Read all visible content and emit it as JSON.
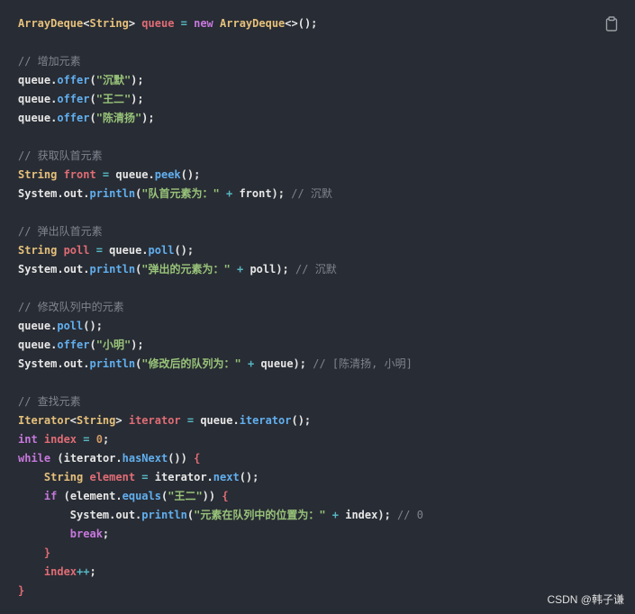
{
  "watermark": "CSDN @韩子谦",
  "copy_icon": "clipboard-icon",
  "lines": [
    [
      [
        "type",
        "ArrayDeque"
      ],
      [
        "punc",
        "<"
      ],
      [
        "type",
        "String"
      ],
      [
        "punc",
        "> "
      ],
      [
        "var",
        "queue"
      ],
      [
        "op",
        " = "
      ],
      [
        "kw",
        "new "
      ],
      [
        "type",
        "ArrayDeque"
      ],
      [
        "punc",
        "<>();"
      ]
    ],
    [],
    [
      [
        "cmt",
        "// 增加元素"
      ]
    ],
    [
      [
        "plain",
        "queue."
      ],
      [
        "fn",
        "offer"
      ],
      [
        "punc",
        "("
      ],
      [
        "str",
        "\"沉默\""
      ],
      [
        "punc",
        ");"
      ]
    ],
    [
      [
        "plain",
        "queue."
      ],
      [
        "fn",
        "offer"
      ],
      [
        "punc",
        "("
      ],
      [
        "str",
        "\"王二\""
      ],
      [
        "punc",
        ");"
      ]
    ],
    [
      [
        "plain",
        "queue."
      ],
      [
        "fn",
        "offer"
      ],
      [
        "punc",
        "("
      ],
      [
        "str",
        "\"陈清扬\""
      ],
      [
        "punc",
        ");"
      ]
    ],
    [],
    [
      [
        "cmt",
        "// 获取队首元素"
      ]
    ],
    [
      [
        "type",
        "String "
      ],
      [
        "var",
        "front"
      ],
      [
        "op",
        " = "
      ],
      [
        "plain",
        "queue."
      ],
      [
        "fn",
        "peek"
      ],
      [
        "punc",
        "();"
      ]
    ],
    [
      [
        "plain",
        "System.out."
      ],
      [
        "fn",
        "println"
      ],
      [
        "punc",
        "("
      ],
      [
        "str",
        "\"队首元素为：\""
      ],
      [
        "op",
        " + "
      ],
      [
        "plain",
        "front); "
      ],
      [
        "cmt",
        "// 沉默"
      ]
    ],
    [],
    [
      [
        "cmt",
        "// 弹出队首元素"
      ]
    ],
    [
      [
        "type",
        "String "
      ],
      [
        "var",
        "poll"
      ],
      [
        "op",
        " = "
      ],
      [
        "plain",
        "queue."
      ],
      [
        "fn",
        "poll"
      ],
      [
        "punc",
        "();"
      ]
    ],
    [
      [
        "plain",
        "System.out."
      ],
      [
        "fn",
        "println"
      ],
      [
        "punc",
        "("
      ],
      [
        "str",
        "\"弹出的元素为：\""
      ],
      [
        "op",
        " + "
      ],
      [
        "plain",
        "poll); "
      ],
      [
        "cmt",
        "// 沉默"
      ]
    ],
    [],
    [
      [
        "cmt",
        "// 修改队列中的元素"
      ]
    ],
    [
      [
        "plain",
        "queue."
      ],
      [
        "fn",
        "poll"
      ],
      [
        "punc",
        "();"
      ]
    ],
    [
      [
        "plain",
        "queue."
      ],
      [
        "fn",
        "offer"
      ],
      [
        "punc",
        "("
      ],
      [
        "str",
        "\"小明\""
      ],
      [
        "punc",
        ");"
      ]
    ],
    [
      [
        "plain",
        "System.out."
      ],
      [
        "fn",
        "println"
      ],
      [
        "punc",
        "("
      ],
      [
        "str",
        "\"修改后的队列为：\""
      ],
      [
        "op",
        " + "
      ],
      [
        "plain",
        "queue); "
      ],
      [
        "cmt",
        "// [陈清扬, 小明]"
      ]
    ],
    [],
    [
      [
        "cmt",
        "// 查找元素"
      ]
    ],
    [
      [
        "type",
        "Iterator"
      ],
      [
        "punc",
        "<"
      ],
      [
        "type",
        "String"
      ],
      [
        "punc",
        "> "
      ],
      [
        "var",
        "iterator"
      ],
      [
        "op",
        " = "
      ],
      [
        "plain",
        "queue."
      ],
      [
        "fn",
        "iterator"
      ],
      [
        "punc",
        "();"
      ]
    ],
    [
      [
        "kw",
        "int "
      ],
      [
        "var",
        "index"
      ],
      [
        "op",
        " = "
      ],
      [
        "num",
        "0"
      ],
      [
        "punc",
        ";"
      ]
    ],
    [
      [
        "kw",
        "while "
      ],
      [
        "punc",
        "("
      ],
      [
        "plain",
        "iterator."
      ],
      [
        "fn",
        "hasNext"
      ],
      [
        "punc",
        "()) "
      ],
      [
        "var",
        "{"
      ]
    ],
    [
      [
        "plain",
        "    "
      ],
      [
        "type",
        "String "
      ],
      [
        "var",
        "element"
      ],
      [
        "op",
        " = "
      ],
      [
        "plain",
        "iterator."
      ],
      [
        "fn",
        "next"
      ],
      [
        "punc",
        "();"
      ]
    ],
    [
      [
        "plain",
        "    "
      ],
      [
        "kw",
        "if "
      ],
      [
        "punc",
        "("
      ],
      [
        "plain",
        "element."
      ],
      [
        "fn",
        "equals"
      ],
      [
        "punc",
        "("
      ],
      [
        "str",
        "\"王二\""
      ],
      [
        "punc",
        ")) "
      ],
      [
        "var",
        "{"
      ]
    ],
    [
      [
        "plain",
        "        System.out."
      ],
      [
        "fn",
        "println"
      ],
      [
        "punc",
        "("
      ],
      [
        "str",
        "\"元素在队列中的位置为：\""
      ],
      [
        "op",
        " + "
      ],
      [
        "plain",
        "index); "
      ],
      [
        "cmt",
        "// 0"
      ]
    ],
    [
      [
        "plain",
        "        "
      ],
      [
        "kw",
        "break"
      ],
      [
        "punc",
        ";"
      ]
    ],
    [
      [
        "plain",
        "    "
      ],
      [
        "var",
        "}"
      ]
    ],
    [
      [
        "plain",
        "    "
      ],
      [
        "var",
        "index"
      ],
      [
        "op",
        "++"
      ],
      [
        "punc",
        ";"
      ]
    ],
    [
      [
        "var",
        "}"
      ]
    ]
  ]
}
